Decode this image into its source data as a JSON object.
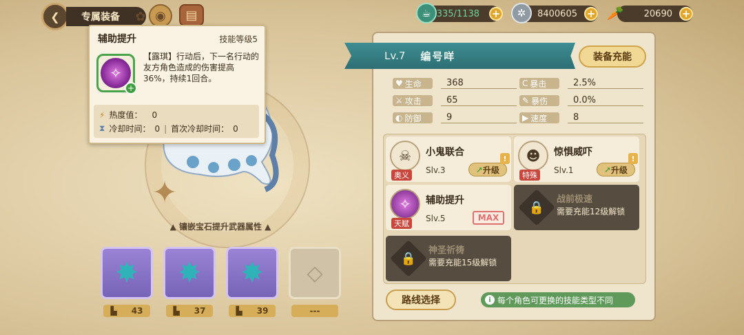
{
  "header": {
    "title": "专属装备",
    "stamina": "335/1138",
    "coins": "8400605",
    "carrots": "20690"
  },
  "tooltip": {
    "title": "辅助提升",
    "level": "技能等级5",
    "desc": "【露琪】行动后，下一名行动的友方角色造成的伤害提高36%，持续1回合。",
    "heat_label": "热度值：",
    "heat_value": "0",
    "cd_label": "冷却时间：",
    "cd_value": "0",
    "first_cd_label": "首次冷却时间：",
    "first_cd_value": "0"
  },
  "left": {
    "hint": "镶嵌宝石提升武器属性",
    "slots": [
      {
        "count": "43"
      },
      {
        "count": "37"
      },
      {
        "count": "39"
      },
      {
        "count": "---"
      }
    ]
  },
  "panel": {
    "level": "Lv.7",
    "name": "编号咩",
    "charge_label": "装备充能",
    "stats": [
      {
        "label": "生命",
        "value": "368"
      },
      {
        "label": "暴击",
        "value": "2.5%"
      },
      {
        "label": "攻击",
        "value": "65"
      },
      {
        "label": "暴伤",
        "value": "0.0%"
      },
      {
        "label": "防御",
        "value": "9"
      },
      {
        "label": "速度",
        "value": "8"
      }
    ],
    "skills": [
      {
        "name": "小鬼联合",
        "tag": "奥义",
        "lv": "Slv.3",
        "action": "升级"
      },
      {
        "name": "惊惧威吓",
        "tag": "特殊",
        "lv": "Slv.1",
        "action": "升级"
      },
      {
        "name": "辅助提升",
        "tag": "天赋",
        "lv": "Slv.5",
        "action": "MAX"
      },
      {
        "name": "战前极速",
        "req": "需要充能12级解锁"
      },
      {
        "name": "神圣祈祷",
        "req": "需要充能15级解锁"
      }
    ],
    "route_label": "路线选择",
    "info": "每个角色可更换的技能类型不同"
  }
}
